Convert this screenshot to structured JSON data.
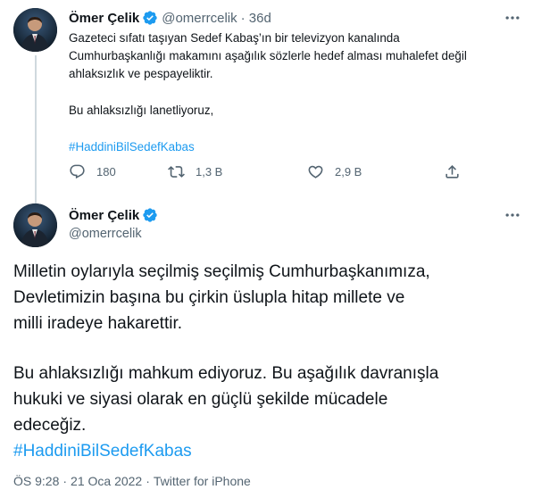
{
  "parent_tweet": {
    "author_name": "Ömer Çelik",
    "handle": "@omerrcelik",
    "age": "· 36d",
    "text_p1": "Gazeteci sıfatı taşıyan Sedef Kabaş’ın bir televizyon kanalında\nCumhurbaşkanlığı  makamını aşağılık sözlerle hedef alması muhalefet değil\nahlaksızlık ve pespayeliktir.",
    "text_p2": "Bu ahlaksızlığı lanetliyoruz,",
    "hashtag": "#HaddiniBilSedefKabas",
    "reply_count": "180",
    "retweet_count": "1,3 B",
    "like_count": "2,9 B"
  },
  "main_tweet": {
    "author_name": "Ömer Çelik",
    "handle": "@omerrcelik",
    "text_p1": "Milletin oylarıyla seçilmiş seçilmiş Cumhurbaşkanımıza,\nDevletimizin başına bu çirkin üslupla hitap millete ve\nmilli iradeye hakarettir.",
    "text_p2": "Bu ahlaksızlığı mahkum ediyoruz. Bu aşağılık davranışla\nhukuki ve siyasi olarak en güçlü şekilde mücadele\nedeceğiz.",
    "hashtag": "#HaddiniBilSedefKabas",
    "time": "ÖS 9:28",
    "date": "21 Oca 2022",
    "source": "Twitter for iPhone",
    "separator": "·"
  },
  "colors": {
    "accent": "#1d9bf0",
    "secondary_text": "#536471",
    "primary_text": "#0f1419",
    "thread_line": "#cfd9de"
  },
  "icons": {
    "verified": "verified-badge-icon",
    "more": "more-dots-icon",
    "reply": "reply-icon",
    "retweet": "retweet-icon",
    "like": "heart-icon",
    "share": "share-icon"
  }
}
